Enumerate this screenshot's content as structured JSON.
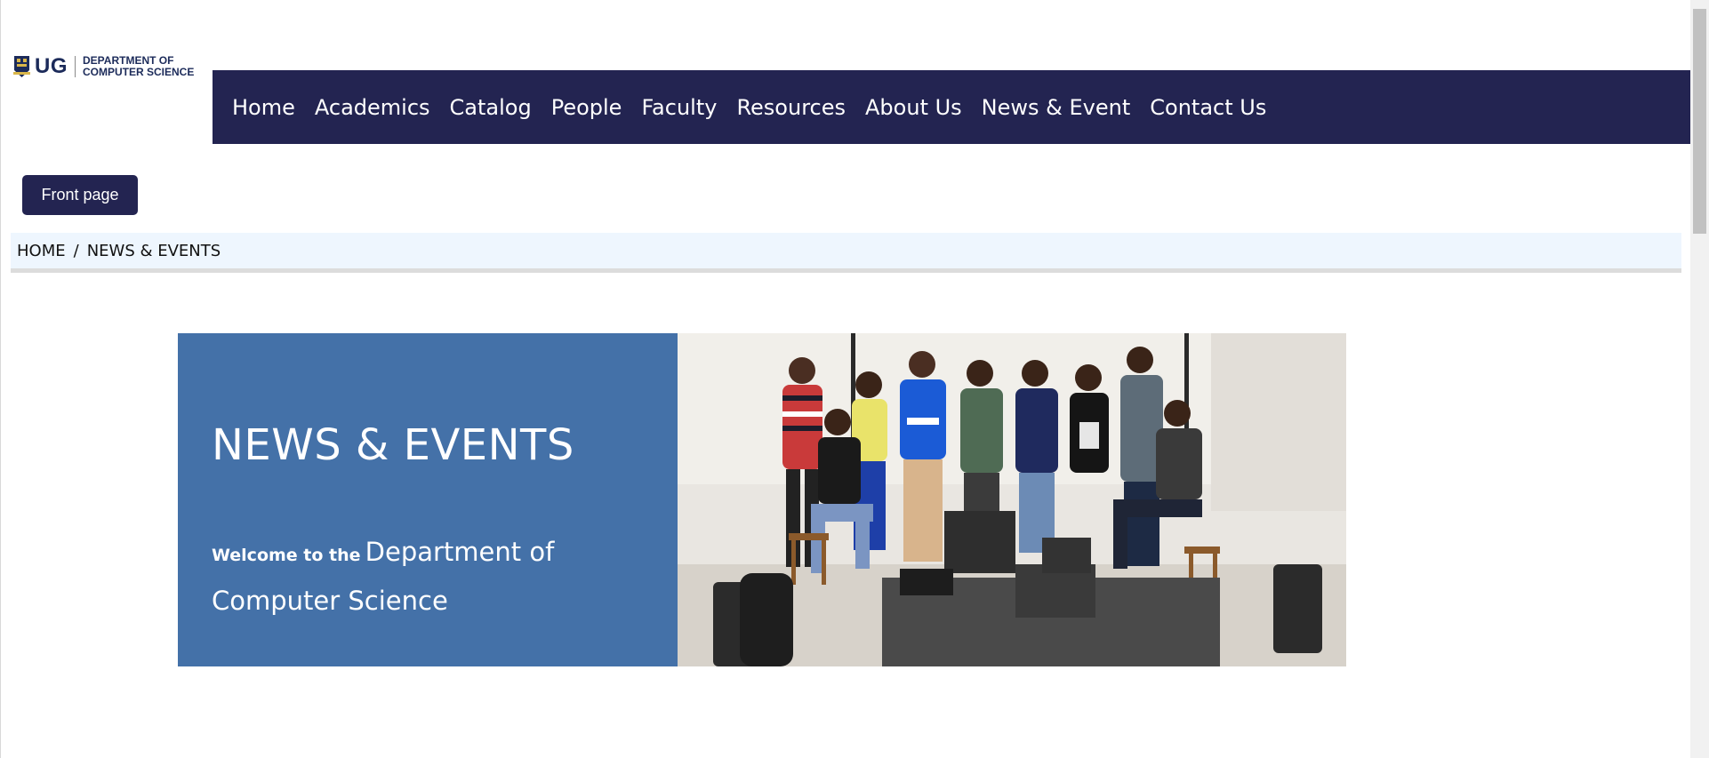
{
  "logo": {
    "abbr": "UG",
    "line1": "DEPARTMENT OF",
    "line2": "COMPUTER SCIENCE",
    "crest_icon": "university-crest-icon"
  },
  "nav": {
    "items": [
      "Home",
      "Academics",
      "Catalog",
      "People",
      "Faculty",
      "Resources",
      "About Us",
      "News & Event",
      "Contact Us"
    ]
  },
  "front_page_button": "Front page",
  "breadcrumb": {
    "home": "HOME",
    "separator": "/",
    "current": "NEWS & EVENTS"
  },
  "hero": {
    "title": "NEWS & EVENTS",
    "welcome_prefix": "Welcome to the",
    "welcome_main": "Department of Computer Science"
  },
  "colors": {
    "nav_bg": "#232451",
    "hero_panel": "#4471a8",
    "breadcrumb_bg": "#eef6fe"
  }
}
